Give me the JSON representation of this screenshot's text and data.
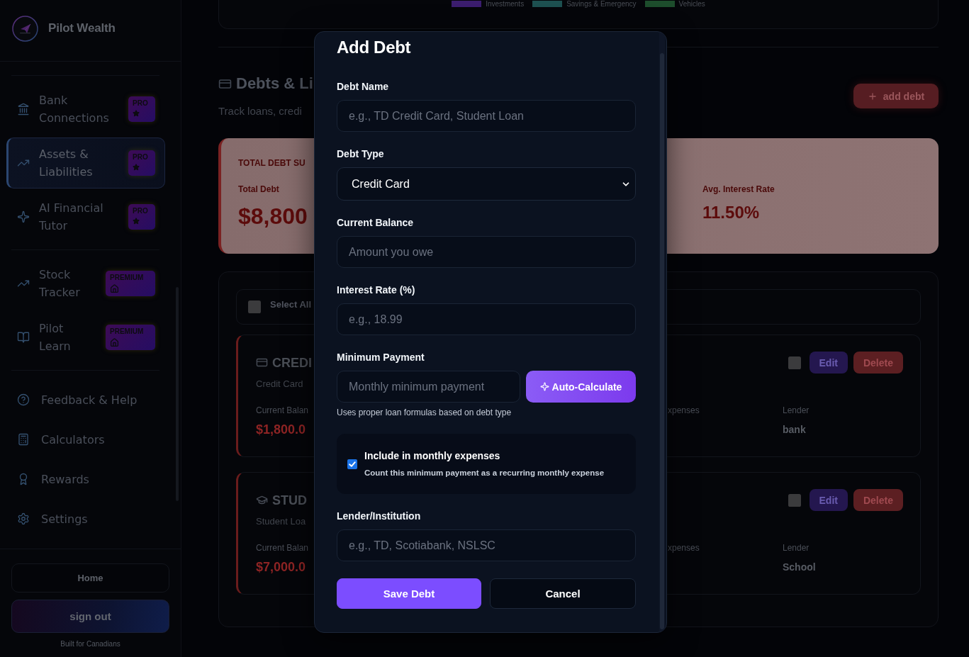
{
  "sidebar": {
    "brand": "Pilot Wealth",
    "groups": [
      {
        "items": [
          {
            "label": "Bank Connections",
            "selected": false,
            "badge": {
              "text": "PRO",
              "kind": "pro"
            }
          },
          {
            "label": "Assets & Liabilities",
            "selected": true,
            "badge": {
              "text": "PRO",
              "kind": "pro"
            }
          },
          {
            "label": "AI Financial Tutor",
            "selected": false,
            "badge": {
              "text": "PRO",
              "kind": "pro"
            }
          }
        ]
      },
      {
        "items": [
          {
            "label": "Stock Tracker",
            "selected": false,
            "badge": {
              "text": "PREMIUM",
              "kind": "premium"
            }
          },
          {
            "label": "Pilot Learn",
            "selected": false,
            "badge": {
              "text": "PREMIUM",
              "kind": "premium"
            }
          }
        ]
      },
      {
        "items": [
          {
            "label": "Feedback & Help",
            "selected": false
          },
          {
            "label": "Calculators",
            "selected": false
          },
          {
            "label": "Rewards",
            "selected": false
          },
          {
            "label": "Settings",
            "selected": false
          }
        ]
      }
    ],
    "home_button": "Home",
    "sign_out_button": "sign out",
    "footer_note": "Built for Canadians"
  },
  "main": {
    "legend": [
      {
        "label": "Investments",
        "color": "#3b1d6e"
      },
      {
        "label": "Savings & Emergency",
        "color": "#1d5050"
      },
      {
        "label": "Vehicles",
        "color": "#1d4d2c"
      }
    ],
    "section": {
      "title": "Debts & Li",
      "subtitle": "Track loans, credi",
      "add_button": "add debt"
    },
    "summary": {
      "heading": "TOTAL DEBT SU",
      "stats": [
        {
          "kind": "total",
          "label": "Total Debt",
          "value": "$8,800"
        },
        {
          "kind": "rate",
          "label": "Avg. Interest Rate",
          "value": "11.50%"
        }
      ]
    },
    "list": {
      "select_all": {
        "label": "Select All",
        "checked": false
      },
      "debts": [
        {
          "title": "CREDI",
          "type": "Credit Card",
          "balance_label": "Current Balan",
          "balance": "$1,800.0",
          "expenses_label": "xpenses",
          "lender_label": "Lender",
          "lender": "bank",
          "checked": false,
          "edit_button": "Edit",
          "delete_button": "Delete"
        },
        {
          "title": "STUD",
          "type": "Student Loa",
          "balance_label": "Current Balan",
          "balance": "$7,000.0",
          "expenses_label": "xpenses",
          "lender_label": "Lender",
          "lender": "School",
          "checked": false,
          "edit_button": "Edit",
          "delete_button": "Delete"
        }
      ]
    }
  },
  "modal": {
    "title": "Add Debt",
    "fields": [
      {
        "kind": "input",
        "label": "Debt Name",
        "placeholder": "e.g., TD Credit Card, Student Loan"
      },
      {
        "kind": "select",
        "label": "Debt Type",
        "value": "Credit Card"
      },
      {
        "kind": "input",
        "label": "Current Balance",
        "placeholder": "Amount you owe"
      },
      {
        "kind": "input",
        "label": "Interest Rate (%)",
        "placeholder": "e.g., 18.99"
      },
      {
        "kind": "calculated",
        "label": "Minimum Payment",
        "placeholder": "Monthly minimum payment",
        "button": "Auto-Calculate",
        "hint": "Uses proper loan formulas based on debt type"
      },
      {
        "kind": "checkbox",
        "label": "Include in monthly expenses",
        "description": "Count this minimum payment as a recurring monthly expense",
        "checked": true
      },
      {
        "kind": "input",
        "label": "Lender/Institution",
        "placeholder": "e.g., TD, Scotiabank, NSLSC"
      }
    ],
    "actions": [
      {
        "kind": "primary",
        "label": "Save Debt"
      },
      {
        "kind": "secondary",
        "label": "Cancel"
      }
    ]
  }
}
